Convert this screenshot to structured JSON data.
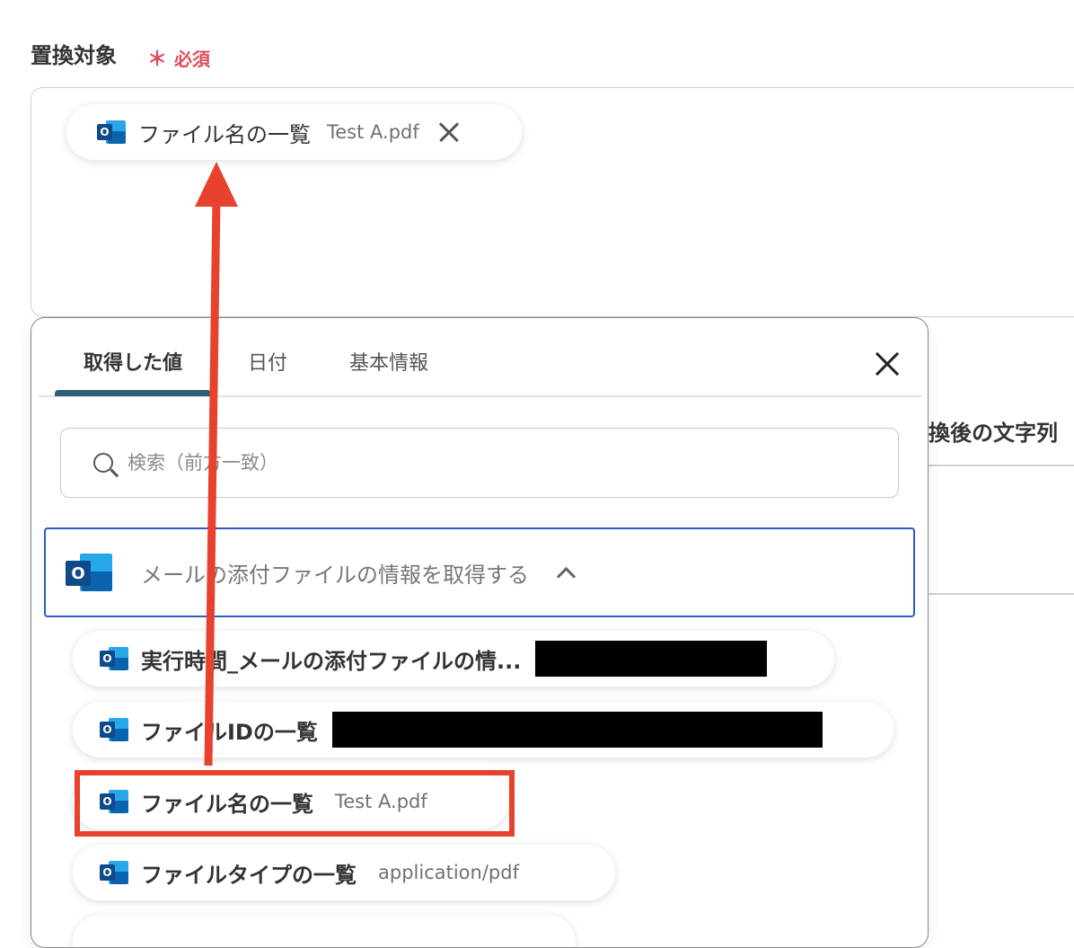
{
  "field": {
    "label": "置換対象",
    "required_mark": "＊",
    "required_text": "必須"
  },
  "selected_chip": {
    "name": "ファイル名の一覧",
    "value": "Test A.pdf"
  },
  "background": {
    "next_field_label": "置換後の文字列"
  },
  "panel": {
    "tabs": [
      "取得した値",
      "日付",
      "基本情報"
    ],
    "search_placeholder": "検索（前方一致）",
    "group_title": "メールの添付ファイルの情報を取得する",
    "items": [
      {
        "name": "実行時間_メールの添付ファイルの情...",
        "value": ""
      },
      {
        "name": "ファイルIDの一覧",
        "value": ""
      },
      {
        "name": "ファイル名の一覧",
        "value": "Test A.pdf"
      },
      {
        "name": "ファイルタイプの一覧",
        "value": "application/pdf"
      }
    ]
  },
  "icons": {
    "outlook_letter": "O"
  },
  "colors": {
    "required": "#e04b5a",
    "annotation": "#e8412d",
    "tab_indicator": "#2f5d78",
    "group_border": "#2d5bc6"
  }
}
